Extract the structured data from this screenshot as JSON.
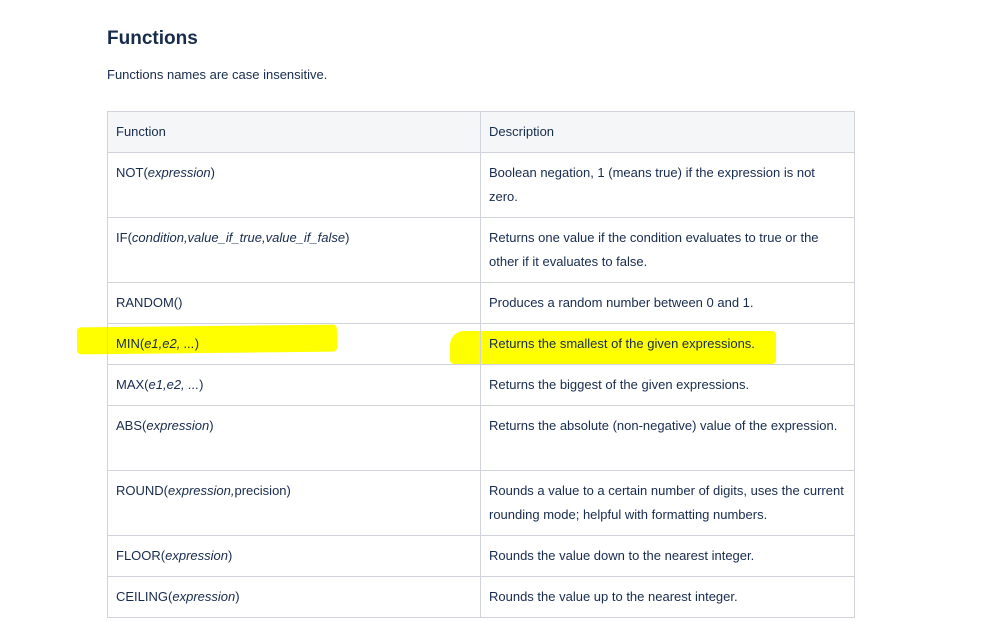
{
  "heading": "Functions",
  "intro": "Functions names are case insensitive.",
  "table": {
    "headers": [
      "Function",
      "Description"
    ],
    "rows": [
      {
        "name": "NOT",
        "args_italic": "expression",
        "args_plain": "",
        "close": ")",
        "description": "Boolean negation, 1 (means true) if the expression is not zero.",
        "highlighted": false
      },
      {
        "name": "IF",
        "args_italic": "condition,value_if_true,value_if_false",
        "args_plain": "",
        "close": ")",
        "description": "Returns one value if the condition evaluates to true or the other if it evaluates to false.",
        "highlighted": false
      },
      {
        "name": "RANDOM",
        "args_italic": "",
        "args_plain": "",
        "close": ")",
        "description": "Produces a random number between 0 and 1.",
        "highlighted": false
      },
      {
        "name": "MIN",
        "args_italic": "e1,e2, ...",
        "args_plain": "",
        "close": ")",
        "description": "Returns the smallest of the given expressions.",
        "highlighted": true
      },
      {
        "name": "MAX",
        "args_italic": "e1,e2, ...",
        "args_plain": "",
        "close": ")",
        "description": "Returns the biggest of the given expressions.",
        "highlighted": false
      },
      {
        "name": "ABS",
        "args_italic": "expression",
        "args_plain": "",
        "close": ")",
        "description": "Returns the absolute (non-negative) value of the expression.",
        "highlighted": false
      },
      {
        "name": "ROUND",
        "args_italic": "expression,",
        "args_plain": "precision",
        "close": ")",
        "description": "Rounds a value to a certain number of digits, uses the current rounding mode; helpful with formatting numbers.",
        "highlighted": false
      },
      {
        "name": "FLOOR",
        "args_italic": "expression",
        "args_plain": "",
        "close": ")",
        "description": "Rounds the value down to the nearest integer.",
        "highlighted": false
      },
      {
        "name": "CEILING",
        "args_italic": "expression",
        "args_plain": "",
        "close": ")",
        "description": "Rounds the value up to the nearest integer.",
        "highlighted": false
      }
    ]
  },
  "colors": {
    "text": "#172b4d",
    "border": "#d0d4da",
    "header_bg": "#f4f5f7",
    "highlight": "#ffff00"
  }
}
